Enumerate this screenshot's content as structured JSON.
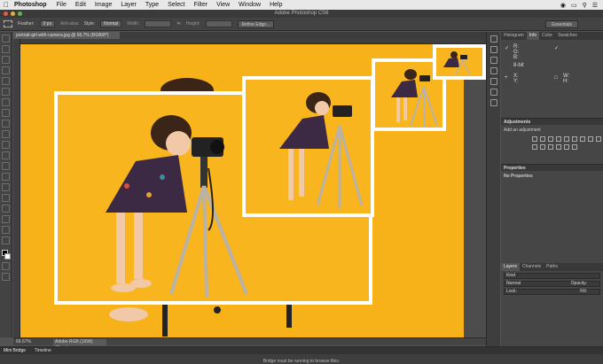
{
  "menubar": {
    "apple": "",
    "app": "Photoshop",
    "items": [
      "File",
      "Edit",
      "Image",
      "Layer",
      "Type",
      "Select",
      "Filter",
      "View",
      "Window",
      "Help"
    ]
  },
  "titlebar": {
    "title": "Adobe Photoshop CS6"
  },
  "options": {
    "feather_label": "Feather:",
    "feather_value": "0 px",
    "antialias": "Anti-alias",
    "style_label": "Style:",
    "style_value": "Normal",
    "width_label": "Width:",
    "height_label": "Height:",
    "refine_button": "Refine Edge...",
    "workspace": "Essentials"
  },
  "document": {
    "tab_title": "portrait-girl-with-camera.jpg @ 66.7% (RGB/8*)"
  },
  "status": {
    "zoom": "66.67%",
    "doc_info": "Adobe RGB (1998) (8bpc)"
  },
  "bottom": {
    "tabs": [
      "Mini Bridge",
      "Timeline"
    ],
    "message": "Bridge must be running to browse files."
  },
  "panels": {
    "top_tabs": [
      "Histogram",
      "Info",
      "Color",
      "Swatches"
    ],
    "top_active": 1,
    "info": {
      "r": "R:",
      "g": "G:",
      "b": "B:",
      "x": "X:",
      "y": "Y:",
      "w": "W:",
      "h": "H:",
      "bits": "8-bit"
    },
    "adjustments_title": "Adjustments",
    "adjustments_hint": "Add an adjustment",
    "properties_title": "Properties",
    "properties_body": "No Properties",
    "layers_tabs": [
      "Layers",
      "Channels",
      "Paths"
    ],
    "layers_kind": "Kind",
    "blend_mode": "Normal",
    "opacity_label": "Opacity:",
    "lock_label": "Lock:",
    "fill_label": "Fill:"
  },
  "colors": {
    "background": "#f7b21a",
    "frame": "#ffffff",
    "chrome": "#535353"
  }
}
